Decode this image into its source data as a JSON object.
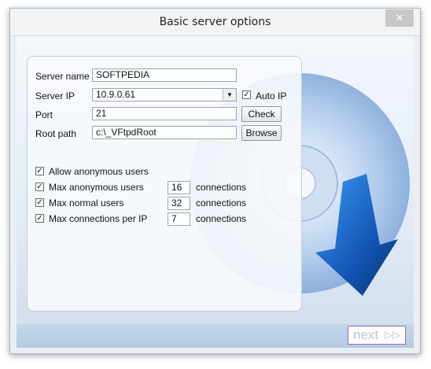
{
  "window": {
    "title": "Basic server options",
    "close_glyph": "✕"
  },
  "form": {
    "server_name_label": "Server name",
    "server_name_value": "SOFTPEDIA",
    "server_ip_label": "Server IP",
    "server_ip_value": "10.9.0.61",
    "auto_ip_label": "Auto IP",
    "auto_ip_checked": true,
    "port_label": "Port",
    "port_value": "21",
    "check_button": "Check",
    "root_path_label": "Root path",
    "root_path_value": "c:\\_VFtpdRoot",
    "browse_button": "Browse"
  },
  "options": [
    {
      "label": "Allow anonymous users",
      "checked": true
    },
    {
      "label": "Max anonymous users",
      "checked": true,
      "value": "16",
      "unit": "connections"
    },
    {
      "label": "Max normal users",
      "checked": true,
      "value": "32",
      "unit": "connections"
    },
    {
      "label": "Max connections per IP",
      "checked": true,
      "value": "7",
      "unit": "connections"
    }
  ],
  "footer": {
    "next_label": "next",
    "next_arrows": "▷▷"
  },
  "colors": {
    "disc_blue": "#1f6fd1",
    "arrow_blue": "#1a73e8",
    "next_border": "#9b6fa3"
  },
  "icons": {
    "check": "✓",
    "dropdown": "▼"
  }
}
